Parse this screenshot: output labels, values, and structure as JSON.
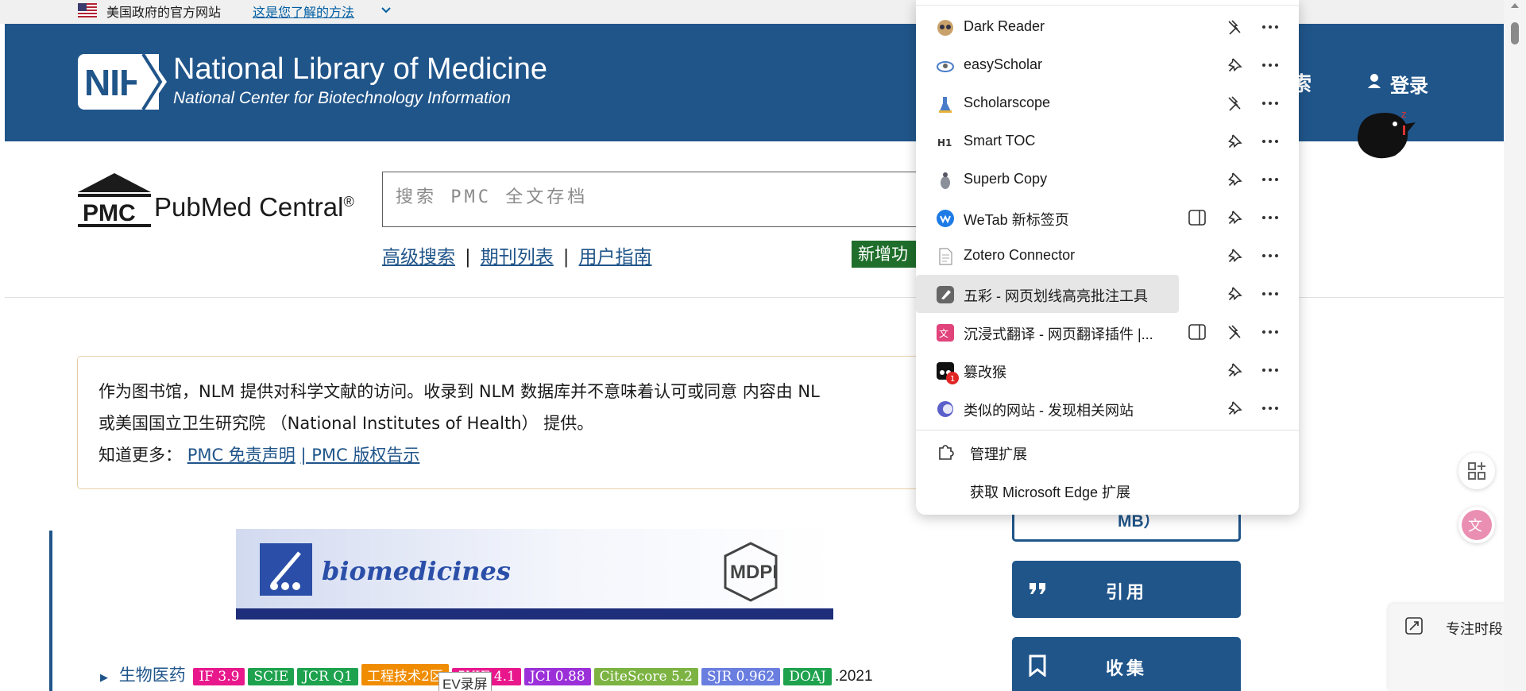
{
  "gov_banner": {
    "text": "美国政府的官方网站",
    "link": "这是您了解的方法"
  },
  "nih_header": {
    "logo": "NIH",
    "title": "National Library of Medicine",
    "subtitle": "National Center for Biotechnology Information",
    "search_partial": "索",
    "login": "登录"
  },
  "pmc": {
    "logo": "PMC",
    "title": "PubMed Central",
    "reg": "®",
    "search_placeholder": "搜索 PMC 全文存档",
    "links": [
      "高级搜索",
      "期刊列表",
      "用户指南"
    ],
    "separator": "|",
    "new_badge": "新增功"
  },
  "notice": {
    "line1": "作为图书馆，NLM 提供对科学文献的访问。收录到 NLM 数据库并不意味着认可或同意 内容由 NL",
    "line2": "或美国国立卫生研究院 （National Institutes of Health） 提供。",
    "line3_prefix": "知道更多：",
    "link1": "PMC 免责声明",
    "link2": "| PMC 版权告示"
  },
  "journal": {
    "banner_name": "biomedicines",
    "banner_publisher": "MDPI",
    "name": "生物医药",
    "tags": [
      {
        "text": "IF 3.9",
        "color": "#e8188c"
      },
      {
        "text": "SCIE",
        "color": "#1ea24e"
      },
      {
        "text": "JCR Q1",
        "color": "#1ea24e"
      },
      {
        "text": "工程技术2区",
        "color": "#f08c00"
      },
      {
        "text": "5YIF 4.1",
        "color": "#e8188c"
      },
      {
        "text": "JCI 0.88",
        "color": "#9b30d9"
      },
      {
        "text": "CiteScore 5.2",
        "color": "#7cb342"
      },
      {
        "text": "SJR 0.962",
        "color": "#6a7ee0"
      },
      {
        "text": "DOAJ",
        "color": "#1ea24e"
      }
    ],
    "year": ".2021",
    "ev_label": "EV录屏"
  },
  "right_actions": {
    "outline_label": "MB）",
    "cite": "引用",
    "collect": "收集"
  },
  "focus": {
    "label": "专注时段"
  },
  "extensions": {
    "items": [
      {
        "name": "Dark Reader",
        "pinned": false,
        "side": false
      },
      {
        "name": "easyScholar",
        "pinned": true,
        "side": false
      },
      {
        "name": "Scholarscope",
        "pinned": false,
        "side": false
      },
      {
        "name": "Smart TOC",
        "pinned": true,
        "side": false
      },
      {
        "name": "Superb Copy",
        "pinned": true,
        "side": false
      },
      {
        "name": "WeTab 新标签页",
        "pinned": true,
        "side": true
      },
      {
        "name": "Zotero Connector",
        "pinned": true,
        "side": false
      },
      {
        "name": "五彩 - 网页划线高亮批注工具",
        "pinned": true,
        "side": false
      },
      {
        "name": "沉浸式翻译 - 网页翻译插件 |...",
        "pinned": false,
        "side": true
      },
      {
        "name": "篡改猴",
        "pinned": true,
        "side": false,
        "badge": "1"
      },
      {
        "name": "类似的网站 - 发现相关网站",
        "pinned": true,
        "side": false
      }
    ],
    "manage": "管理扩展",
    "get": "获取 Microsoft Edge 扩展"
  }
}
